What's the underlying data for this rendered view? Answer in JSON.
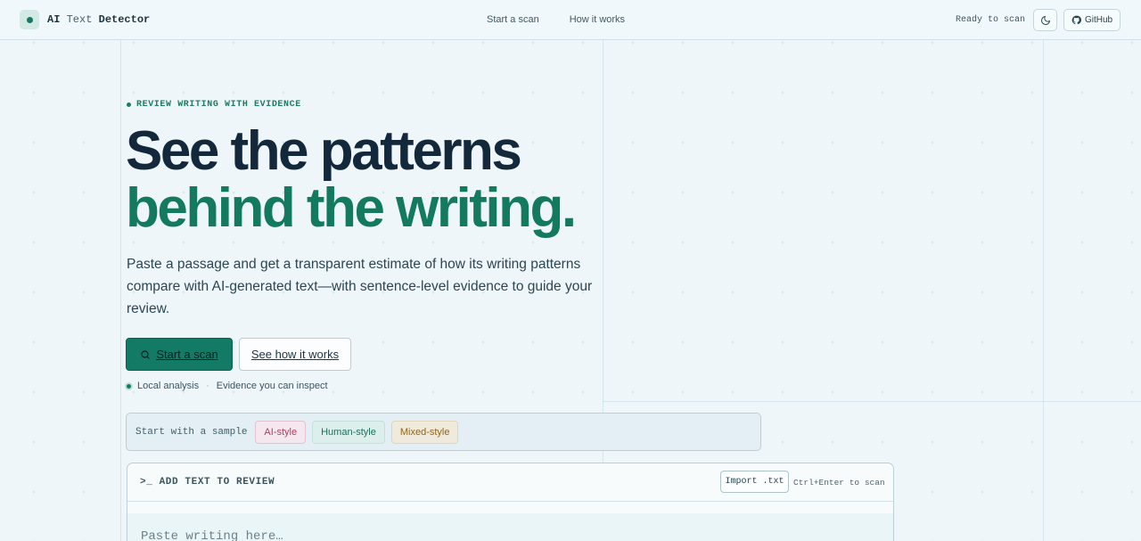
{
  "header": {
    "brand_ai": "AI",
    "brand_text": "Text",
    "brand_detector": "Detector",
    "nav": [
      "Start a scan",
      "How it works"
    ],
    "status": "Ready to scan",
    "github_label": "GitHub"
  },
  "hero": {
    "eyebrow": "REVIEW WRITING WITH EVIDENCE",
    "title_line1": "See the patterns",
    "title_line2": "behind the writing.",
    "lede": "Paste a passage and get a transparent estimate of how its writing patterns compare with AI-generated text—with sentence-level evidence to guide your review.",
    "primary_cta": "Start a scan",
    "secondary_cta": "See how it works",
    "meta_local": "Local analysis",
    "meta_sep": "·",
    "meta_evidence": "Evidence you can inspect"
  },
  "samples": {
    "label": "Start with a sample",
    "chips": [
      "AI-style",
      "Human-style",
      "Mixed-style"
    ]
  },
  "editor": {
    "title": "ADD TEXT TO REVIEW",
    "import_label": "Import .txt",
    "shortcut": "Ctrl+Enter to scan",
    "placeholder": "Paste writing here…"
  },
  "colors": {
    "accent": "#137a5f",
    "primary_button": "#137a66",
    "chip_ai": "#b23c62",
    "chip_human": "#1d6e5c",
    "chip_mixed": "#946316"
  },
  "icons": [
    "moon-icon",
    "github-icon",
    "search-icon",
    "terminal-icon"
  ]
}
